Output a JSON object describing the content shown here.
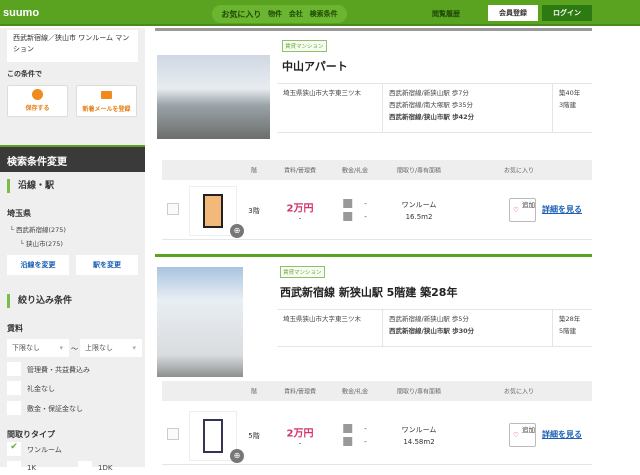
{
  "header": {
    "logo": "suumo",
    "nav": [
      "お気に入り",
      "物件",
      "会社",
      "検索条件"
    ],
    "history": "閲覧履歴",
    "register": "会員登録",
    "login": "ログイン"
  },
  "sidebar": {
    "condition_text": "西武新宿線／狭山市 ワンルーム マンション",
    "with_condition": "この条件で",
    "save_label": "保存する",
    "mail_label": "新着メールを登録",
    "section_title": "検索条件変更",
    "line_station": "沿線・駅",
    "prefecture": "埼玉県",
    "line": "└ 西武新宿線(275)",
    "station": "└ 狭山市(275)",
    "change_line": "沿線を変更",
    "change_station": "駅を変更",
    "filter_title": "絞り込み条件",
    "rent_label": "賃料",
    "rent_min": "下限なし",
    "rent_sep": "〜",
    "rent_max": "上限なし",
    "checks": [
      "管理費・共益費込み",
      "礼金なし",
      "敷金・保証金なし"
    ],
    "layout_title": "間取りタイプ",
    "layout_checked": "ワンルーム",
    "layout_more": [
      "1K",
      "1DK"
    ]
  },
  "table_headers": [
    "階",
    "賃料/管理費",
    "敷金/礼金",
    "間取り/専有面積",
    "お気に入り"
  ],
  "listings": [
    {
      "tag": "賃貸マンション",
      "title": "中山アパート",
      "address": "埼玉県狭山市大字東三ツ木",
      "access": [
        "西武新宿線/新狭山駅 歩7分",
        "西武新宿線/南大塚駅 歩35分",
        "西武新宿線/狭山市駅 歩42分"
      ],
      "age": "築40年",
      "floors": "3階建",
      "floor": "3階",
      "rent": "2万円",
      "fee": "-",
      "deposit": "-",
      "key_money": "-",
      "layout": "ワンルーム",
      "area": "16.5m2",
      "fav": "追加",
      "detail": "詳細を見る",
      "deposit_icon": "敷",
      "key_icon": "礼"
    },
    {
      "tag": "賃貸マンション",
      "title": "西武新宿線 新狭山駅 5階建 築28年",
      "address": "埼玉県狭山市大字東三ツ木",
      "access": [
        "西武新宿線/新狭山駅 歩5分",
        "西武新宿線/狭山市駅 歩30分"
      ],
      "age": "築28年",
      "floors": "5階建",
      "floor": "5階",
      "rent": "2万円",
      "fee": "-",
      "deposit": "-",
      "key_money": "-",
      "layout": "ワンルーム",
      "area": "14.58m2",
      "fav": "追加",
      "detail": "詳細を見る",
      "deposit_icon": "敷",
      "key_icon": "礼"
    }
  ]
}
